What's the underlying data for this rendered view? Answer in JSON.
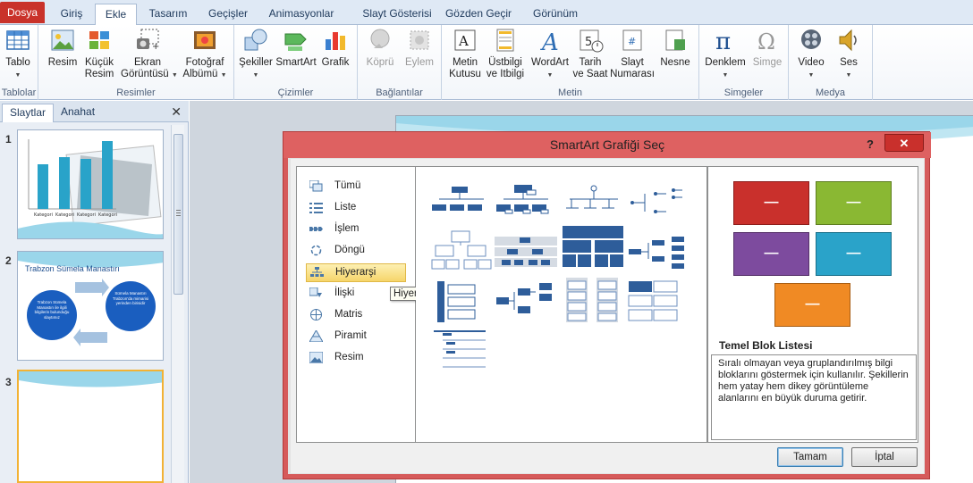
{
  "tabs": [
    {
      "label": "Dosya"
    },
    {
      "label": "Giriş"
    },
    {
      "label": "Ekle"
    },
    {
      "label": "Tasarım"
    },
    {
      "label": "Geçişler"
    },
    {
      "label": "Animasyonlar"
    },
    {
      "label": "Slayt Gösterisi"
    },
    {
      "label": "Gözden Geçir"
    },
    {
      "label": "Görünüm"
    }
  ],
  "active_tab": "Ekle",
  "ribbon": {
    "groups": {
      "tablolar": "Tablolar",
      "resimler": "Resimler",
      "cizimler": "Çizimler",
      "baglantilar": "Bağlantılar",
      "metin": "Metin",
      "simgeler": "Simgeler",
      "medya": "Medya"
    },
    "buttons": {
      "tablo": "Tablo",
      "resim": "Resim",
      "kucuk_resim_1": "Küçük",
      "kucuk_resim_2": "Resim",
      "ekran_1": "Ekran",
      "ekran_2": "Görüntüsü",
      "fotograf_1": "Fotoğraf",
      "fotograf_2": "Albümü",
      "sekiller": "Şekiller",
      "smartart": "SmartArt",
      "grafik": "Grafik",
      "kopru": "Köprü",
      "eylem": "Eylem",
      "metin_kutusu_1": "Metin",
      "metin_kutusu_2": "Kutusu",
      "ustbilgi_1": "Üstbilgi",
      "ustbilgi_2": "ve Itbilgi",
      "wordart": "WordArt",
      "tarih_1": "Tarih",
      "tarih_2": "ve Saat",
      "slayt_no_1": "Slayt",
      "slayt_no_2": "Numarası",
      "nesne": "Nesne",
      "denklem": "Denklem",
      "simge": "Simge",
      "video": "Video",
      "ses": "Ses"
    }
  },
  "left_panel": {
    "tabs": [
      "Slaytlar",
      "Anahat"
    ],
    "close": "✕",
    "slides": [
      {
        "number": "1",
        "chart_labels": [
          "Kategori",
          "Kategori",
          "Kategori",
          "Kategori"
        ]
      },
      {
        "number": "2",
        "title": "Trabzon Sümela Manastırı",
        "left_circle": "Trabzon Sümela Manastırı ile ilgili bilgilerin bulunduğu slaytımız",
        "right_circle": "Sümela Manastırı Trabzon'da mimarisi yerinden birisidir"
      },
      {
        "number": "3"
      }
    ]
  },
  "dialog": {
    "title": "SmartArt Grafiği Seç",
    "help": "?",
    "close": "✕",
    "categories": [
      "Tümü",
      "Liste",
      "İşlem",
      "Döngü",
      "Hiyerarşi",
      "İlişki",
      "Matris",
      "Piramit",
      "Resim"
    ],
    "selected_category": "Hiyerarşi",
    "tooltip": "Hiyerarşi",
    "preview": {
      "title": "Temel Blok Listesi",
      "description": "Sıralı olmayan veya gruplandırılmış bilgi bloklarını göstermek için kullanılır. Şekillerin hem yatay hem dikey görüntüleme alanlarını en büyük duruma getirir.",
      "box_label": "—",
      "colors": [
        "#c9302c",
        "#8ab833",
        "#7d4b9e",
        "#2aa3c9",
        "#f08a24"
      ]
    },
    "ok": "Tamam",
    "cancel": "İptal"
  }
}
